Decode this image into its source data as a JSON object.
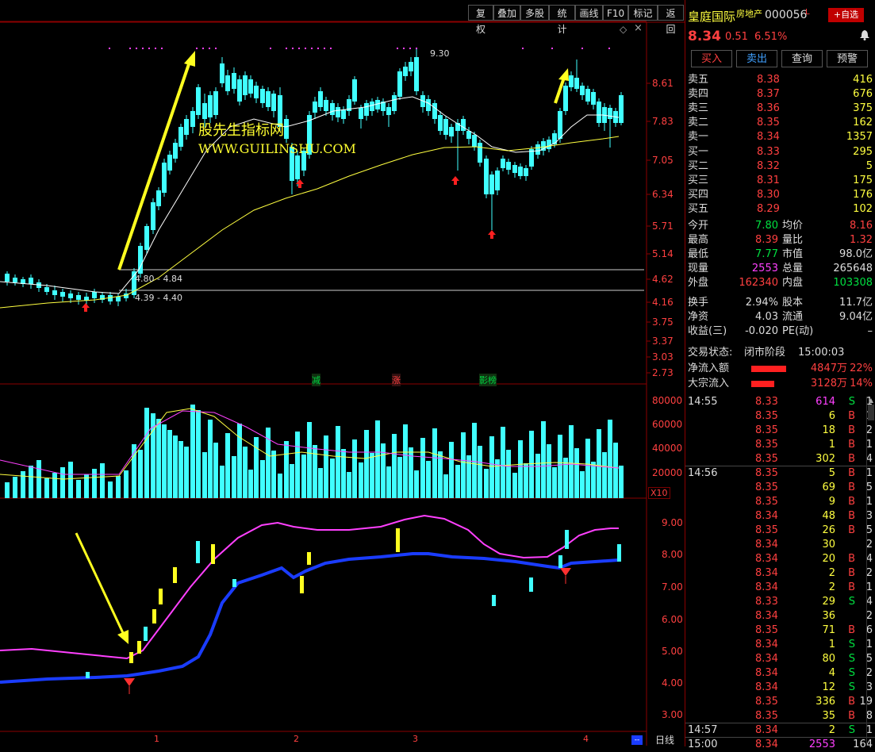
{
  "toolbar": {
    "items": [
      "复权",
      "叠加",
      "多股",
      "统计",
      "画线",
      "F10",
      "标记",
      "返回"
    ]
  },
  "chart": {
    "price_ticks": [
      "8.61",
      "7.83",
      "7.05",
      "6.34",
      "5.71",
      "5.14",
      "4.62",
      "4.16",
      "3.75",
      "3.37",
      "3.03",
      "2.73"
    ],
    "high_label": "9.30",
    "range_upper_label": "4.80 - 4.84",
    "range_lower_label": "4.39 - 4.40",
    "watermark_line1": "股先生指标网",
    "watermark_line2": "WWW.GUILINSHU.COM",
    "event_tags": [
      "减",
      "涨",
      "影榜"
    ],
    "volume_ticks": [
      "80000",
      "60000",
      "40000",
      "20000"
    ],
    "volume_unit": "X10",
    "indicator_ticks": [
      "9.00",
      "8.00",
      "7.00",
      "6.00",
      "5.00",
      "4.00",
      "3.00"
    ],
    "x_ticks": [
      "1",
      "2",
      "3",
      "4"
    ],
    "period_label": "日线",
    "colors": {
      "up": "#ff3030",
      "down": "#40ffff",
      "ma_white": "#ffffff",
      "ma_yellow": "#ffff40",
      "upper_band": "#ff40ff",
      "lower_band": "#1a3cff",
      "arrow": "#ffff20"
    }
  },
  "chart_data": {
    "type": "candlestick",
    "price_axis_ticks": [
      8.61,
      7.83,
      7.05,
      6.34,
      5.71,
      5.14,
      4.62,
      4.16,
      3.75,
      3.37,
      3.03,
      2.73
    ],
    "annotated_high": 9.3,
    "volume_axis_ticks": [
      80000,
      60000,
      40000,
      20000
    ],
    "volume_multiplier": 10,
    "indicator_axis_ticks": [
      9.0,
      8.0,
      7.0,
      6.0,
      5.0,
      4.0,
      3.0
    ]
  },
  "stock": {
    "name": "皇庭国际",
    "sector": "房地产",
    "code": "000056",
    "flag": "L",
    "watch_button": "+自选",
    "price": "8.34",
    "change": "0.51",
    "change_pct": "6.51%"
  },
  "trade_buttons": [
    "买入",
    "卖出",
    "查询",
    "预警"
  ],
  "order_book": {
    "sells": [
      {
        "label": "卖五",
        "price": "8.38",
        "vol": "416"
      },
      {
        "label": "卖四",
        "price": "8.37",
        "vol": "676"
      },
      {
        "label": "卖三",
        "price": "8.36",
        "vol": "375"
      },
      {
        "label": "卖二",
        "price": "8.35",
        "vol": "162"
      },
      {
        "label": "卖一",
        "price": "8.34",
        "vol": "1357"
      }
    ],
    "buys": [
      {
        "label": "买一",
        "price": "8.33",
        "vol": "295"
      },
      {
        "label": "买二",
        "price": "8.32",
        "vol": "5"
      },
      {
        "label": "买三",
        "price": "8.31",
        "vol": "175"
      },
      {
        "label": "买四",
        "price": "8.30",
        "vol": "176"
      },
      {
        "label": "买五",
        "price": "8.29",
        "vol": "102"
      }
    ]
  },
  "stats": [
    {
      "l1": "今开",
      "v1": "7.80",
      "c1": "green",
      "l2": "均价",
      "v2": "8.16",
      "c2": "red"
    },
    {
      "l1": "最高",
      "v1": "8.39",
      "c1": "red",
      "l2": "量比",
      "v2": "1.32",
      "c2": "red"
    },
    {
      "l1": "最低",
      "v1": "7.77",
      "c1": "green",
      "l2": "市值",
      "v2": "98.0亿",
      "c2": "white"
    },
    {
      "l1": "现量",
      "v1": "2553",
      "c1": "mag",
      "l2": "总量",
      "v2": "265648",
      "c2": "white"
    },
    {
      "l1": "外盘",
      "v1": "162340",
      "c1": "red",
      "l2": "内盘",
      "v2": "103308",
      "c2": "green"
    }
  ],
  "stats2": [
    {
      "l1": "换手",
      "v1": "2.94%",
      "l2": "股本",
      "v2": "11.7亿"
    },
    {
      "l1": "净资",
      "v1": "4.03",
      "l2": "流通",
      "v2": "9.04亿"
    },
    {
      "l1": "收益(三)",
      "v1": "-0.020",
      "l2": "PE(动)",
      "v2": "–"
    }
  ],
  "status": {
    "label": "交易状态:",
    "value": "闭市阶段",
    "time": "15:00:03"
  },
  "flows": [
    {
      "label": "净流入额",
      "value": "4847万",
      "pct": "22%",
      "bar": 0.85
    },
    {
      "label": "大宗流入",
      "value": "3128万",
      "pct": "14%",
      "bar": 0.55
    }
  ],
  "ticks": [
    {
      "time": "14:55",
      "price": "8.33",
      "vol": "614",
      "side": "S",
      "n": "1",
      "vc": "mag"
    },
    {
      "time": "",
      "price": "8.35",
      "vol": "6",
      "side": "B",
      "n": "1",
      "vc": "yellow"
    },
    {
      "time": "",
      "price": "8.35",
      "vol": "18",
      "side": "B",
      "n": "2",
      "vc": "yellow"
    },
    {
      "time": "",
      "price": "8.35",
      "vol": "1",
      "side": "B",
      "n": "1",
      "vc": "yellow"
    },
    {
      "time": "",
      "price": "8.35",
      "vol": "302",
      "side": "B",
      "n": "4",
      "vc": "yellow"
    },
    {
      "time": "14:56",
      "price": "8.35",
      "vol": "5",
      "side": "B",
      "n": "1",
      "vc": "yellow"
    },
    {
      "time": "",
      "price": "8.35",
      "vol": "69",
      "side": "B",
      "n": "5",
      "vc": "yellow"
    },
    {
      "time": "",
      "price": "8.35",
      "vol": "9",
      "side": "B",
      "n": "1",
      "vc": "yellow"
    },
    {
      "time": "",
      "price": "8.34",
      "vol": "48",
      "side": "B",
      "n": "3",
      "vc": "yellow"
    },
    {
      "time": "",
      "price": "8.35",
      "vol": "26",
      "side": "B",
      "n": "5",
      "vc": "yellow"
    },
    {
      "time": "",
      "price": "8.34",
      "vol": "30",
      "side": "",
      "n": "2",
      "vc": "yellow"
    },
    {
      "time": "",
      "price": "8.34",
      "vol": "20",
      "side": "B",
      "n": "4",
      "vc": "yellow"
    },
    {
      "time": "",
      "price": "8.34",
      "vol": "2",
      "side": "B",
      "n": "2",
      "vc": "yellow"
    },
    {
      "time": "",
      "price": "8.34",
      "vol": "2",
      "side": "B",
      "n": "1",
      "vc": "yellow"
    },
    {
      "time": "",
      "price": "8.33",
      "vol": "29",
      "side": "S",
      "n": "4",
      "vc": "yellow"
    },
    {
      "time": "",
      "price": "8.34",
      "vol": "36",
      "side": "",
      "n": "2",
      "vc": "yellow"
    },
    {
      "time": "",
      "price": "8.35",
      "vol": "71",
      "side": "B",
      "n": "6",
      "vc": "yellow"
    },
    {
      "time": "",
      "price": "8.34",
      "vol": "1",
      "side": "S",
      "n": "1",
      "vc": "yellow"
    },
    {
      "time": "",
      "price": "8.34",
      "vol": "80",
      "side": "S",
      "n": "5",
      "vc": "yellow"
    },
    {
      "time": "",
      "price": "8.34",
      "vol": "4",
      "side": "S",
      "n": "2",
      "vc": "yellow"
    },
    {
      "time": "",
      "price": "8.34",
      "vol": "12",
      "side": "S",
      "n": "3",
      "vc": "yellow"
    },
    {
      "time": "",
      "price": "8.35",
      "vol": "336",
      "side": "B",
      "n": "19",
      "vc": "yellow"
    },
    {
      "time": "",
      "price": "8.35",
      "vol": "35",
      "side": "B",
      "n": "8",
      "vc": "yellow"
    },
    {
      "time": "14:57",
      "price": "8.34",
      "vol": "2",
      "side": "S",
      "n": "1",
      "vc": "yellow"
    },
    {
      "time": "15:00",
      "price": "8.34",
      "vol": "2553",
      "side": "",
      "n": "164",
      "vc": "mag"
    }
  ]
}
